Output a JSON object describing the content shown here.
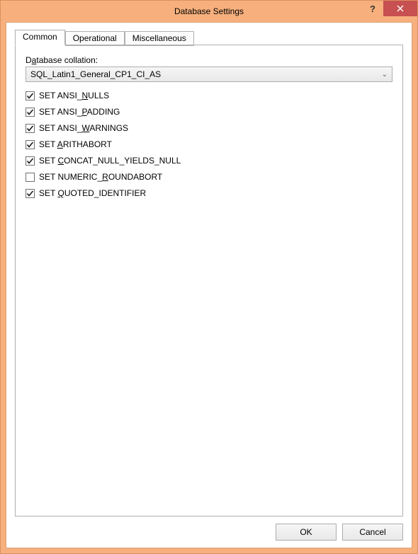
{
  "window": {
    "title": "Database Settings"
  },
  "tabs": [
    {
      "label": "Common",
      "active": true
    },
    {
      "label": "Operational",
      "active": false
    },
    {
      "label": "Miscellaneous",
      "active": false
    }
  ],
  "collation": {
    "label_pre": "D",
    "label_ul": "a",
    "label_post": "tabase collation:",
    "value": "SQL_Latin1_General_CP1_CI_AS"
  },
  "options": [
    {
      "checked": true,
      "pre": "SET ANSI_",
      "ul": "N",
      "post": "ULLS"
    },
    {
      "checked": true,
      "pre": "SET ANSI_",
      "ul": "P",
      "post": "ADDING"
    },
    {
      "checked": true,
      "pre": "SET ANSI_",
      "ul": "W",
      "post": "ARNINGS"
    },
    {
      "checked": true,
      "pre": "SET ",
      "ul": "A",
      "post": "RITHABORT"
    },
    {
      "checked": true,
      "pre": "SET ",
      "ul": "C",
      "post": "ONCAT_NULL_YIELDS_NULL"
    },
    {
      "checked": false,
      "pre": "SET NUMERIC_",
      "ul": "R",
      "post": "OUNDABORT"
    },
    {
      "checked": true,
      "pre": "SET ",
      "ul": "Q",
      "post": "UOTED_IDENTIFIER"
    }
  ],
  "buttons": {
    "ok": "OK",
    "cancel": "Cancel"
  }
}
